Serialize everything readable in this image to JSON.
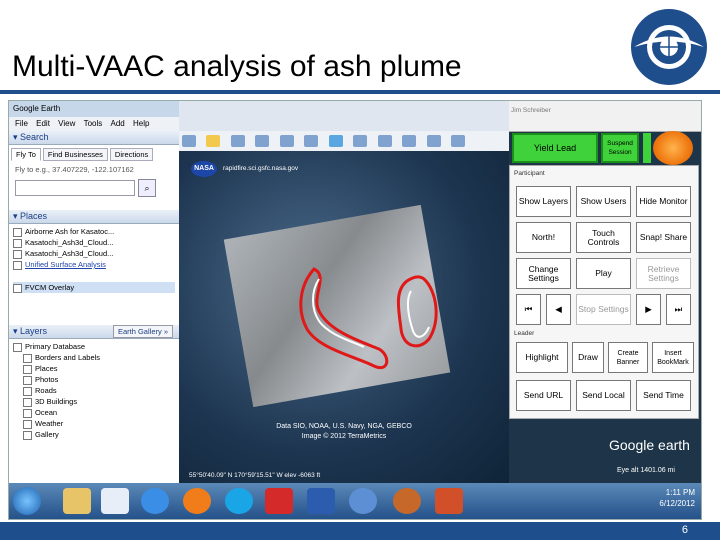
{
  "slide": {
    "title": "Multi-VAAC analysis of ash plume",
    "page_number": "6",
    "logo_text": "ICAO · OACI · ИКАО"
  },
  "google_earth": {
    "window_title": "Google Earth",
    "menu": [
      "File",
      "Edit",
      "View",
      "Tools",
      "Add",
      "Help"
    ],
    "search": {
      "header": "Search",
      "tabs": [
        "Fly To",
        "Find Businesses",
        "Directions"
      ],
      "example": "Fly to e.g., 37.407229, -122.107162"
    },
    "places": {
      "header": "Places",
      "items": [
        {
          "label": "Airborne Ash for Kasatoc...",
          "link": false
        },
        {
          "label": "Kasatochi_Ash3d_Cloud...",
          "link": false
        },
        {
          "label": "Kasatochi_Ash3d_Cloud...",
          "link": false
        },
        {
          "label": "Unified Surface Analysis",
          "link": true
        },
        {
          "label": "FVCM Overlay",
          "link": false
        }
      ]
    },
    "layers": {
      "header": "Layers",
      "gallery_label": "Earth Gallery »",
      "items": [
        "Primary Database",
        "Borders and Labels",
        "Places",
        "Photos",
        "Roads",
        "3D Buildings",
        "Ocean",
        "Weather",
        "Gallery"
      ]
    },
    "map": {
      "nasa_label": "NASA",
      "source_url": "rapidfire.sci.gsfc.nasa.gov",
      "attribution": "Data SIO, NOAA, U.S. Navy, NGA, GEBCO",
      "image_credit": "Image © 2012 TerraMetrics",
      "coords": "55°50'40.09\" N  170°59'15.51\" W  elev -6063 ft",
      "eye_alt": "Eye alt  1401.06 mi",
      "logo": "Google earth"
    }
  },
  "collab_panel": {
    "slide_name": "Jim Schreiber",
    "yield_label": "Yield Lead",
    "suspend_label": "Suspend Session",
    "participant_label": "Participant",
    "leader_label": "Leader",
    "buttons": [
      {
        "label": "Show Layers",
        "enabled": true
      },
      {
        "label": "Show Users",
        "enabled": true
      },
      {
        "label": "Hide Monitor",
        "enabled": true
      },
      {
        "label": "North!",
        "enabled": true
      },
      {
        "label": "Touch Controls",
        "enabled": true
      },
      {
        "label": "Snap! Share",
        "enabled": true
      },
      {
        "label": "Change Settings",
        "enabled": true
      },
      {
        "label": "Play",
        "enabled": true
      },
      {
        "label": "Retrieve Settings",
        "enabled": false
      },
      {
        "label": "Stop Settings",
        "enabled": false
      },
      {
        "label": "Highlight",
        "enabled": true
      },
      {
        "label": "Draw",
        "enabled": true
      },
      {
        "label": "Create Banner",
        "enabled": true
      },
      {
        "label": "Insert BookMark",
        "enabled": true
      },
      {
        "label": "Send URL",
        "enabled": true
      },
      {
        "label": "Send Local",
        "enabled": true
      },
      {
        "label": "Send Time",
        "enabled": true
      }
    ]
  },
  "taskbar": {
    "time": "1:11 PM",
    "date": "6/12/2012"
  },
  "colors": {
    "brand_blue": "#1f4e8c",
    "active_green": "#3fd23a",
    "plume_red": "#e01818"
  }
}
